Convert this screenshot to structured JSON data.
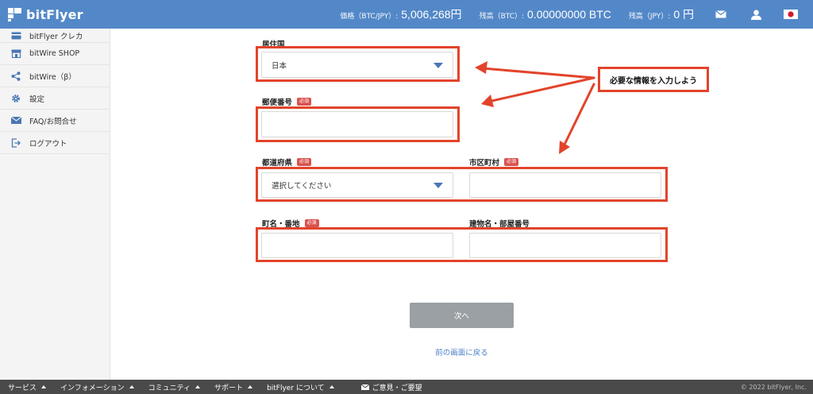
{
  "header": {
    "logo_text": "bitFlyer",
    "price_label": "価格（BTC/JPY）:",
    "price_value": "5,006,268円",
    "btc_label": "残高（BTC）:",
    "btc_value": "0.00000000 BTC",
    "jpy_label": "残高（JPY）:",
    "jpy_value": "0 円",
    "icons": [
      "mail-icon",
      "user-icon",
      "japan-flag-icon"
    ],
    "accent_color": "#5388c8"
  },
  "sidebar": {
    "items": [
      {
        "label": "bitFlyer クレカ",
        "icon": "card-icon"
      },
      {
        "label": "bitWire SHOP",
        "icon": "shop-icon"
      },
      {
        "label": "bitWire（β）",
        "icon": "share-icon"
      },
      {
        "label": "設定",
        "icon": "gear-icon"
      },
      {
        "label": "FAQ/お問合せ",
        "icon": "mail-icon"
      },
      {
        "label": "ログアウト",
        "icon": "logout-icon"
      }
    ]
  },
  "form": {
    "country_label": "居住国",
    "country_value": "日本",
    "postal_label": "郵便番号",
    "required_badge": "必須",
    "prefecture_label": "都道府県",
    "prefecture_value": "選択してください",
    "city_label": "市区町村",
    "street_label": "町名・番地",
    "building_label": "建物名・部屋番号",
    "next_button": "次へ",
    "back_link": "前の画面に戻る",
    "annotation": "必要な情報を入力しよう",
    "highlight_color": "#e2442b"
  },
  "footer": {
    "items": [
      "サービス",
      "インフォメーション",
      "コミュニティ",
      "サポート",
      "bitFlyer について"
    ],
    "feedback": "ご意見・ご要望",
    "copyright": "© 2022 bitFlyer, Inc."
  }
}
